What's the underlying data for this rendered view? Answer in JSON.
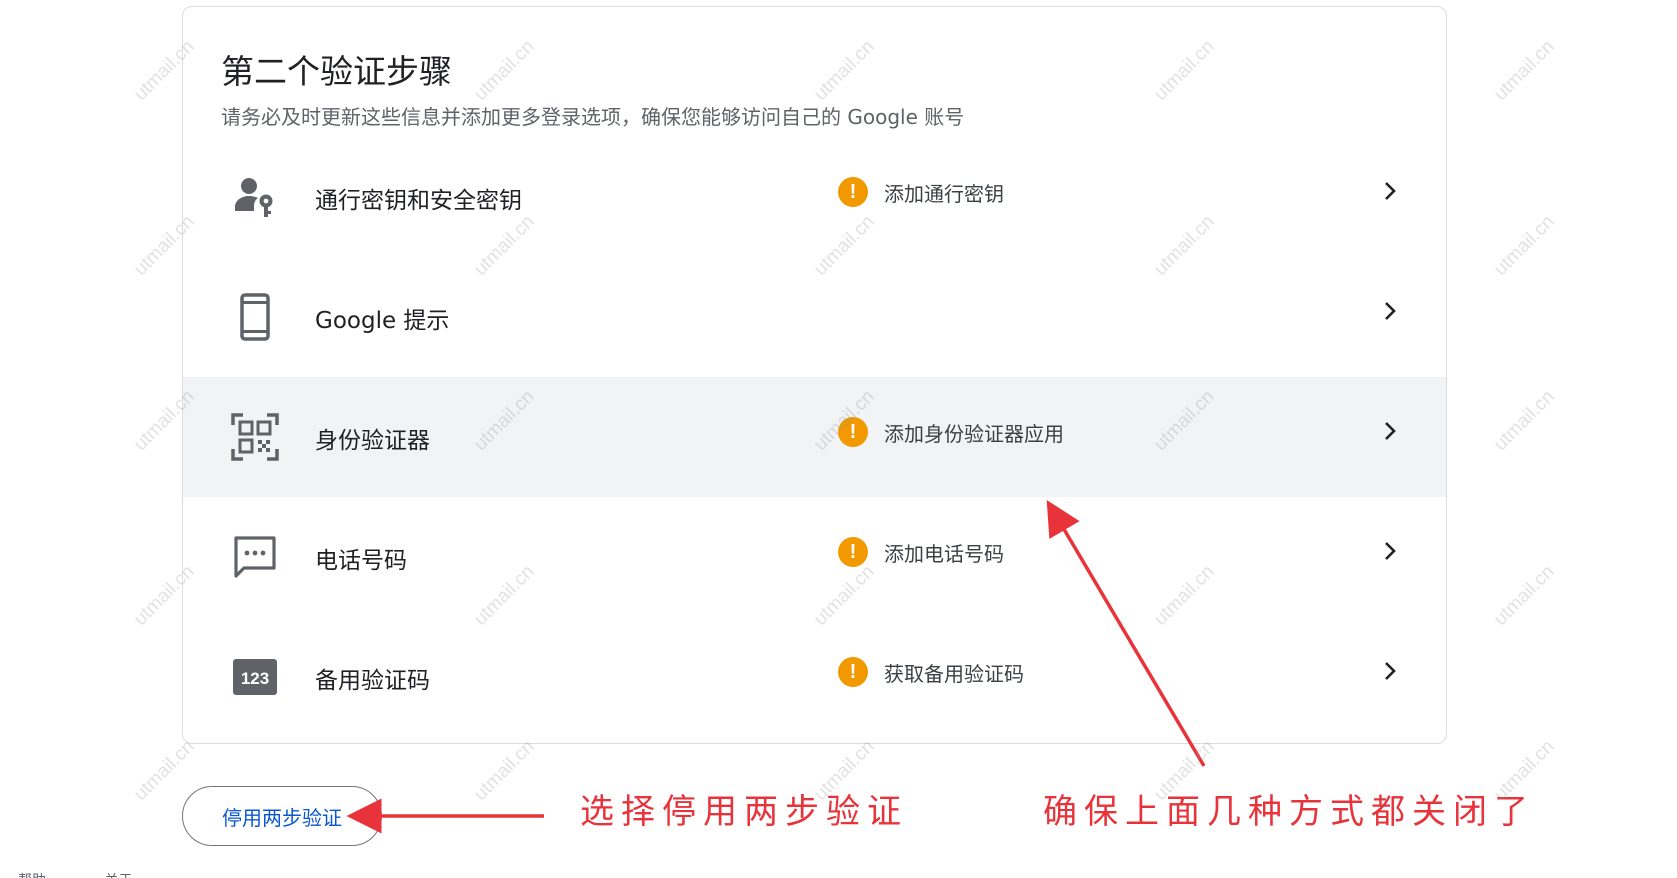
{
  "section": {
    "title": "第二个验证步骤",
    "subtitle": "请务必及时更新这些信息并添加更多登录选项，确保您能够访问自己的 Google 账号"
  },
  "methods": [
    {
      "label": "通行密钥和安全密钥",
      "status": "添加通行密钥",
      "icon": "person-key-icon"
    },
    {
      "label": "Google 提示",
      "status": "",
      "icon": "phone-icon"
    },
    {
      "label": "身份验证器",
      "status": "添加身份验证器应用",
      "icon": "qr-code-icon"
    },
    {
      "label": "电话号码",
      "status": "添加电话号码",
      "icon": "sms-icon"
    },
    {
      "label": "备用验证码",
      "status": "获取备用验证码",
      "icon": "backup-codes-icon"
    }
  ],
  "warning_mark": "!",
  "backup_badge": "123",
  "disable_button": "停用两步验证",
  "annotations": {
    "left": "选择停用两步验证",
    "right": "确保上面几种方式都关闭了"
  },
  "footer": [
    "帮助",
    "关于"
  ],
  "watermark": "utmail.cn",
  "colors": {
    "warning": "#f29900",
    "link": "#0b57d0",
    "annotation": "#e8333a",
    "highlight_row": "#f1f3f4"
  }
}
